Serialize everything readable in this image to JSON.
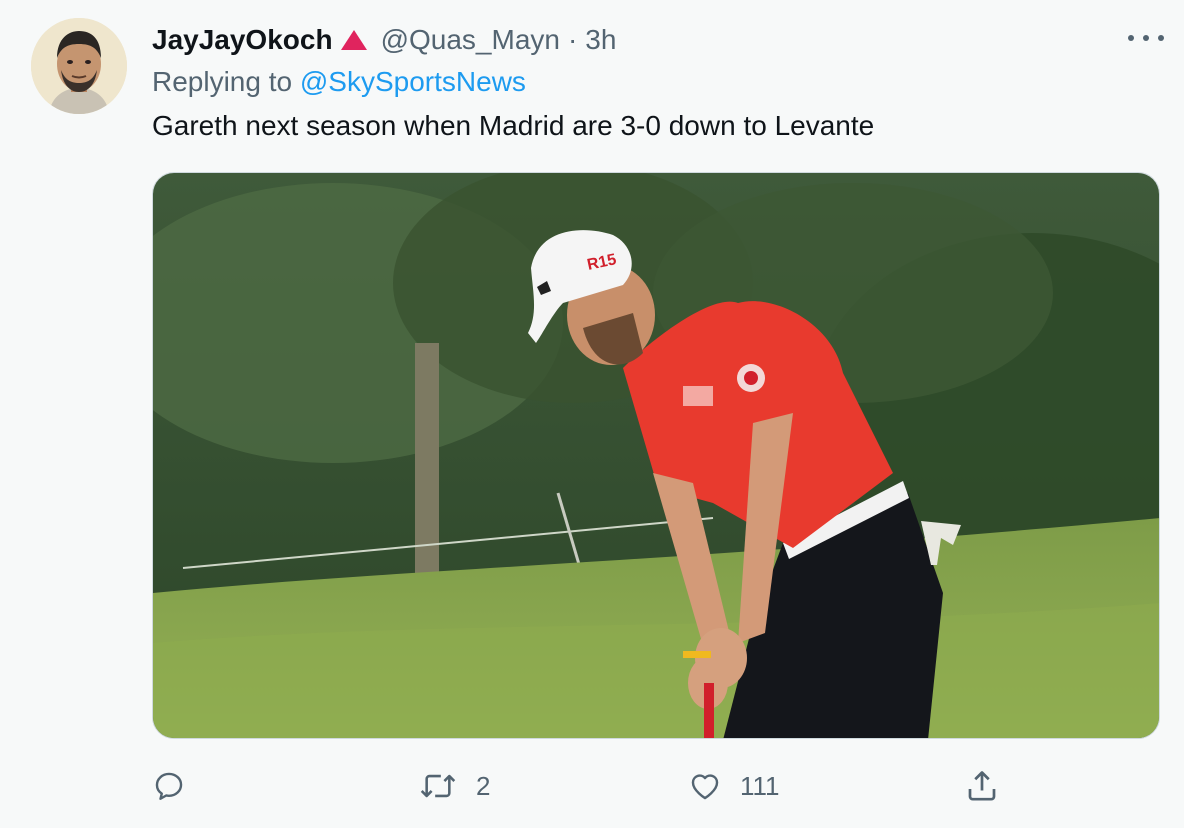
{
  "tweet": {
    "author_name": "JayJayOkoch",
    "handle": "@Quas_Mayn",
    "separator": "·",
    "time": "3h",
    "reply_prefix": "Replying to",
    "reply_mention": "@SkySportsNews",
    "text": "Gareth next season when Madrid are 3-0 down to Levante",
    "badge_color": "#e0245e",
    "cap_logo": "R15"
  },
  "actions": {
    "reply_icon": "reply-icon",
    "retweet_icon": "retweet-icon",
    "retweet_count": "2",
    "like_icon": "heart-icon",
    "like_count": "111",
    "share_icon": "share-icon"
  },
  "colors": {
    "text_primary": "#0f1419",
    "text_secondary": "#536471",
    "link": "#1d9bf0",
    "background": "#f7f9f9"
  }
}
